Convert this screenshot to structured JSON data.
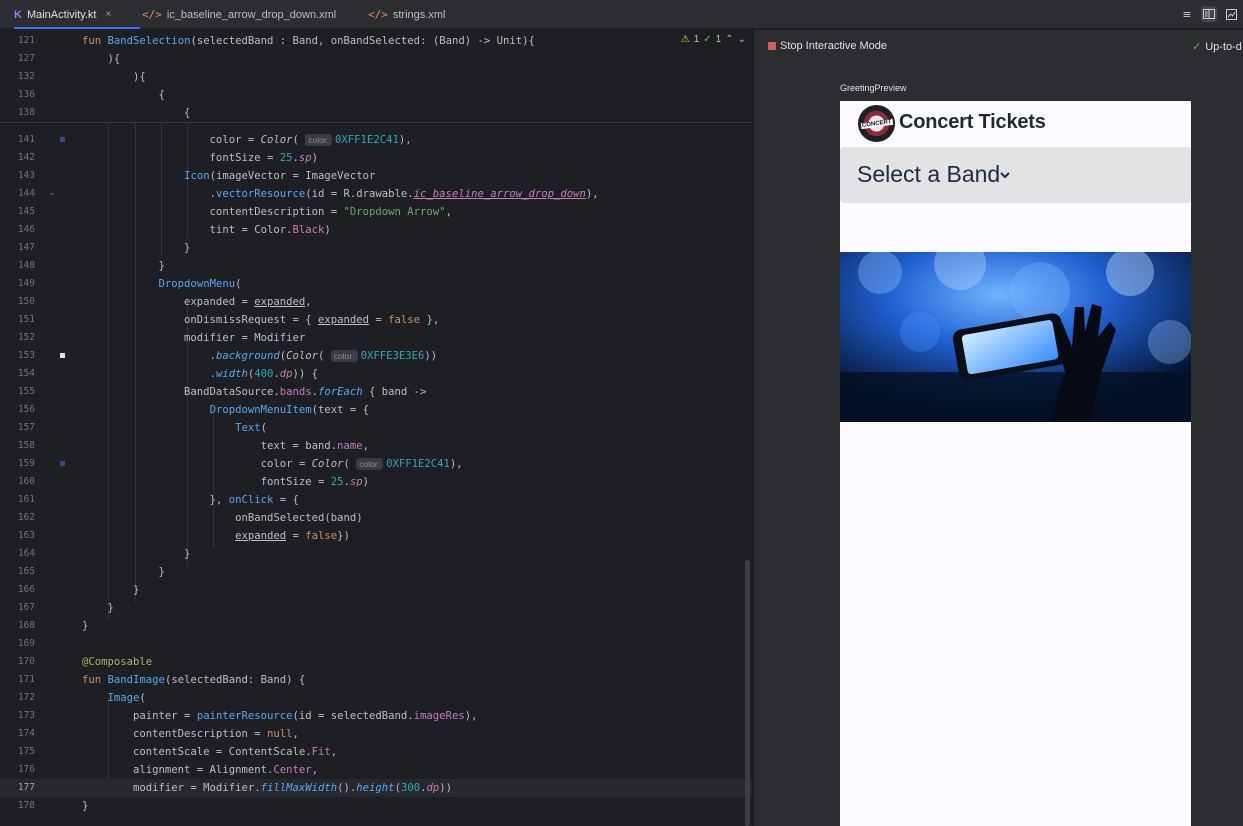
{
  "tabs": [
    {
      "label": "MainActivity.kt",
      "icon": "kotlin-file-icon",
      "active": true
    },
    {
      "label": "ic_baseline_arrow_drop_down.xml",
      "icon": "xml-file-icon",
      "active": false
    },
    {
      "label": "strings.xml",
      "icon": "xml-file-icon",
      "active": false
    }
  ],
  "editor": {
    "inspection": {
      "warnings": "1",
      "ok": "1"
    },
    "hints": {
      "color": "color:"
    }
  },
  "preview": {
    "stop_label": "Stop Interactive Mode",
    "status_label": "Up-to-d",
    "preview_name": "GreetingPreview",
    "app_title": "Concert Tickets",
    "select_label": "Select a Band",
    "logo_text": "CONCERT"
  },
  "colors": {
    "accent": "#3574f0",
    "keyword": "#cf8e6d",
    "function": "#56a8f5",
    "string": "#6aab73",
    "number": "#2aacb8",
    "dropdown_bg": "#E3E3E6",
    "band_text": "#1E2C41"
  }
}
